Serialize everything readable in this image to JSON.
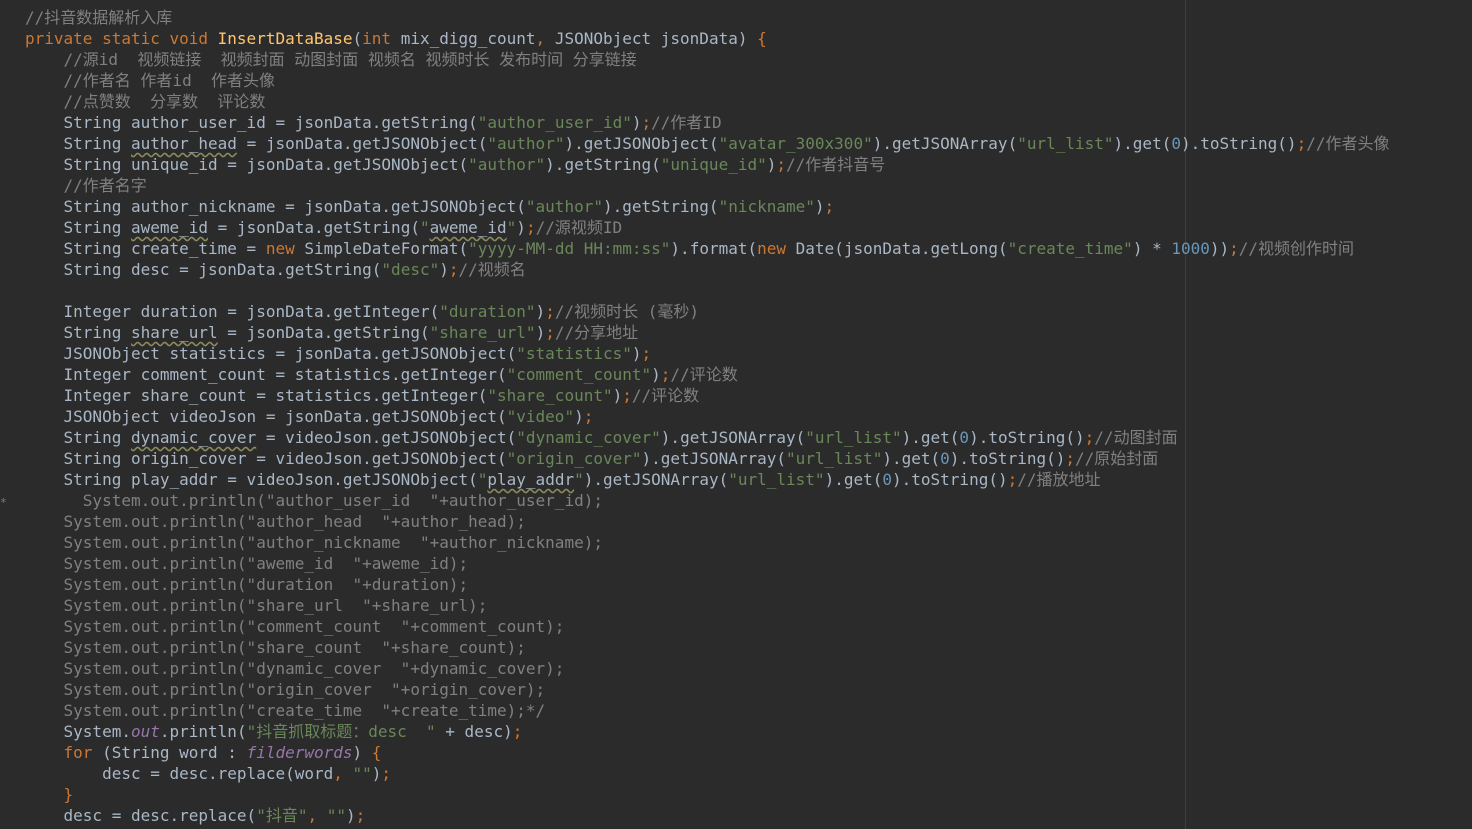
{
  "editor": {
    "colors": {
      "background": "#2b2b2b",
      "default": "#a9b7c6",
      "comment": "#808080",
      "keyword": "#cc7832",
      "string": "#6a8759",
      "function": "#ffc66d",
      "number": "#6897bb",
      "field": "#9876aa"
    },
    "gutter_mark": "*",
    "lines": [
      [
        [
          "cmt",
          "//抖音数据解析入库"
        ]
      ],
      [
        [
          "kw",
          "private static void "
        ],
        [
          "fn",
          "InsertDataBase"
        ],
        [
          "plain",
          "("
        ],
        [
          "kw",
          "int "
        ],
        [
          "plain",
          "mix_digg_count"
        ],
        [
          "kw",
          ", "
        ],
        [
          "plain",
          "JSONObject jsonData) "
        ],
        [
          "kw",
          "{"
        ]
      ],
      [
        [
          "plain",
          "    "
        ],
        [
          "cmt",
          "//源id  视频链接  视频封面 动图封面 视频名 视频时长 发布时间 分享链接"
        ]
      ],
      [
        [
          "plain",
          "    "
        ],
        [
          "cmt",
          "//作者名 作者id  作者头像"
        ]
      ],
      [
        [
          "plain",
          "    "
        ],
        [
          "cmt",
          "//点赞数  分享数  评论数"
        ]
      ],
      [
        [
          "plain",
          "    String author_user_id = jsonData.getString("
        ],
        [
          "str",
          "\"author_user_id\""
        ],
        [
          "plain",
          ")"
        ],
        [
          "kw",
          ";"
        ],
        [
          "cmt",
          "//作者ID"
        ]
      ],
      [
        [
          "plain",
          "    String "
        ],
        [
          "warn",
          "author_head"
        ],
        [
          "plain",
          " = jsonData.getJSONObject("
        ],
        [
          "str",
          "\"author\""
        ],
        [
          "plain",
          ").getJSONObject("
        ],
        [
          "str",
          "\"avatar_300x300\""
        ],
        [
          "plain",
          ").getJSONArray("
        ],
        [
          "str",
          "\"url_list\""
        ],
        [
          "plain",
          ").get("
        ],
        [
          "num",
          "0"
        ],
        [
          "plain",
          ").toString()"
        ],
        [
          "kw",
          ";"
        ],
        [
          "cmt",
          "//作者头像"
        ]
      ],
      [
        [
          "plain",
          "    String unique_id = jsonData.getJSONObject("
        ],
        [
          "str",
          "\"author\""
        ],
        [
          "plain",
          ").getString("
        ],
        [
          "str",
          "\"unique_id\""
        ],
        [
          "plain",
          ")"
        ],
        [
          "kw",
          ";"
        ],
        [
          "cmt",
          "//作者抖音号"
        ]
      ],
      [
        [
          "plain",
          "    "
        ],
        [
          "cmt",
          "//作者名字"
        ]
      ],
      [
        [
          "plain",
          "    String author_nickname = jsonData.getJSONObject("
        ],
        [
          "str",
          "\"author\""
        ],
        [
          "plain",
          ").getString("
        ],
        [
          "str",
          "\"nickname\""
        ],
        [
          "plain",
          ")"
        ],
        [
          "kw",
          ";"
        ]
      ],
      [
        [
          "plain",
          "    String "
        ],
        [
          "warn",
          "aweme_id"
        ],
        [
          "plain",
          " = jsonData.getString("
        ],
        [
          "str",
          "\""
        ],
        [
          "warn",
          "aweme_id"
        ],
        [
          "str",
          "\""
        ],
        [
          "plain",
          ")"
        ],
        [
          "kw",
          ";"
        ],
        [
          "cmt",
          "//源视频ID"
        ]
      ],
      [
        [
          "plain",
          "    String create_time = "
        ],
        [
          "kw",
          "new "
        ],
        [
          "plain",
          "SimpleDateFormat("
        ],
        [
          "str",
          "\"yyyy-MM-dd HH:mm:ss\""
        ],
        [
          "plain",
          ").format("
        ],
        [
          "kw",
          "new "
        ],
        [
          "plain",
          "Date(jsonData.getLong("
        ],
        [
          "str",
          "\"create_time\""
        ],
        [
          "plain",
          ") * "
        ],
        [
          "num",
          "1000"
        ],
        [
          "plain",
          "))"
        ],
        [
          "kw",
          ";"
        ],
        [
          "cmt",
          "//视频创作时间"
        ]
      ],
      [
        [
          "plain",
          "    String desc = jsonData.getString("
        ],
        [
          "str",
          "\"desc\""
        ],
        [
          "plain",
          ")"
        ],
        [
          "kw",
          ";"
        ],
        [
          "cmt",
          "//视频名"
        ]
      ],
      [
        [
          "plain",
          ""
        ]
      ],
      [
        [
          "plain",
          "    Integer duration = jsonData.getInteger("
        ],
        [
          "str",
          "\"duration\""
        ],
        [
          "plain",
          ")"
        ],
        [
          "kw",
          ";"
        ],
        [
          "cmt",
          "//视频时长 (毫秒)"
        ]
      ],
      [
        [
          "plain",
          "    String "
        ],
        [
          "warn",
          "share_url"
        ],
        [
          "plain",
          " = jsonData.getString("
        ],
        [
          "str",
          "\"share_url\""
        ],
        [
          "plain",
          ")"
        ],
        [
          "kw",
          ";"
        ],
        [
          "cmt",
          "//分享地址"
        ]
      ],
      [
        [
          "plain",
          "    JSONObject statistics = jsonData.getJSONObject("
        ],
        [
          "str",
          "\"statistics\""
        ],
        [
          "plain",
          ")"
        ],
        [
          "kw",
          ";"
        ]
      ],
      [
        [
          "plain",
          "    Integer comment_count = statistics.getInteger("
        ],
        [
          "str",
          "\"comment_count\""
        ],
        [
          "plain",
          ")"
        ],
        [
          "kw",
          ";"
        ],
        [
          "cmt",
          "//评论数"
        ]
      ],
      [
        [
          "plain",
          "    Integer share_count = statistics.getInteger("
        ],
        [
          "str",
          "\"share_count\""
        ],
        [
          "plain",
          ")"
        ],
        [
          "kw",
          ";"
        ],
        [
          "cmt",
          "//评论数"
        ]
      ],
      [
        [
          "plain",
          "    JSONObject videoJson = jsonData.getJSONObject("
        ],
        [
          "str",
          "\"video\""
        ],
        [
          "plain",
          ")"
        ],
        [
          "kw",
          ";"
        ]
      ],
      [
        [
          "plain",
          "    String "
        ],
        [
          "warn",
          "dynamic_cover"
        ],
        [
          "plain",
          " = videoJson.getJSONObject("
        ],
        [
          "str",
          "\"dynamic_cover\""
        ],
        [
          "plain",
          ").getJSONArray("
        ],
        [
          "str",
          "\"url_list\""
        ],
        [
          "plain",
          ").get("
        ],
        [
          "num",
          "0"
        ],
        [
          "plain",
          ").toString()"
        ],
        [
          "kw",
          ";"
        ],
        [
          "cmt",
          "//动图封面"
        ]
      ],
      [
        [
          "plain",
          "    String origin_cover = videoJson.getJSONObject("
        ],
        [
          "str",
          "\"origin_cover\""
        ],
        [
          "plain",
          ").getJSONArray("
        ],
        [
          "str",
          "\"url_list\""
        ],
        [
          "plain",
          ").get("
        ],
        [
          "num",
          "0"
        ],
        [
          "plain",
          ").toString()"
        ],
        [
          "kw",
          ";"
        ],
        [
          "cmt",
          "//原始封面"
        ]
      ],
      [
        [
          "plain",
          "    String play_addr = videoJson.getJSONObject("
        ],
        [
          "str",
          "\""
        ],
        [
          "warn",
          "play_addr"
        ],
        [
          "str",
          "\""
        ],
        [
          "plain",
          ").getJSONArray("
        ],
        [
          "str",
          "\"url_list\""
        ],
        [
          "plain",
          ").get("
        ],
        [
          "num",
          "0"
        ],
        [
          "plain",
          ").toString()"
        ],
        [
          "kw",
          ";"
        ],
        [
          "cmt",
          "//播放地址"
        ]
      ],
      [
        [
          "cmt",
          "      System.out.println(\"author_user_id  \"+author_user_id);"
        ]
      ],
      [
        [
          "cmt",
          "    System.out.println(\"author_head  \"+author_head);"
        ]
      ],
      [
        [
          "cmt",
          "    System.out.println(\"author_nickname  \"+author_nickname);"
        ]
      ],
      [
        [
          "cmt",
          "    System.out.println(\"aweme_id  \"+aweme_id);"
        ]
      ],
      [
        [
          "cmt",
          "    System.out.println(\"duration  \"+duration);"
        ]
      ],
      [
        [
          "cmt",
          "    System.out.println(\"share_url  \"+share_url);"
        ]
      ],
      [
        [
          "cmt",
          "    System.out.println(\"comment_count  \"+comment_count);"
        ]
      ],
      [
        [
          "cmt",
          "    System.out.println(\"share_count  \"+share_count);"
        ]
      ],
      [
        [
          "cmt",
          "    System.out.println(\"dynamic_cover  \"+dynamic_cover);"
        ]
      ],
      [
        [
          "cmt",
          "    System.out.println(\"origin_cover  \"+origin_cover);"
        ]
      ],
      [
        [
          "cmt",
          "    System.out.println(\"create_time  \"+create_time);*/"
        ]
      ],
      [
        [
          "plain",
          "    System."
        ],
        [
          "fld",
          "out"
        ],
        [
          "plain",
          ".println("
        ],
        [
          "str",
          "\"抖音抓取标题：desc  \""
        ],
        [
          "plain",
          " + desc)"
        ],
        [
          "kw",
          ";"
        ]
      ],
      [
        [
          "plain",
          "    "
        ],
        [
          "kw",
          "for "
        ],
        [
          "plain",
          "(String word : "
        ],
        [
          "fld",
          "filderwords"
        ],
        [
          "plain",
          ") "
        ],
        [
          "kw",
          "{"
        ]
      ],
      [
        [
          "plain",
          "        desc = desc.replace(word"
        ],
        [
          "kw",
          ", "
        ],
        [
          "str",
          "\"\""
        ],
        [
          "plain",
          ")"
        ],
        [
          "kw",
          ";"
        ]
      ],
      [
        [
          "plain",
          "    "
        ],
        [
          "kw",
          "}"
        ]
      ],
      [
        [
          "plain",
          "    desc = desc.replace("
        ],
        [
          "str",
          "\"抖音\""
        ],
        [
          "kw",
          ", "
        ],
        [
          "str",
          "\"\""
        ],
        [
          "plain",
          ")"
        ],
        [
          "kw",
          ";"
        ]
      ]
    ]
  }
}
